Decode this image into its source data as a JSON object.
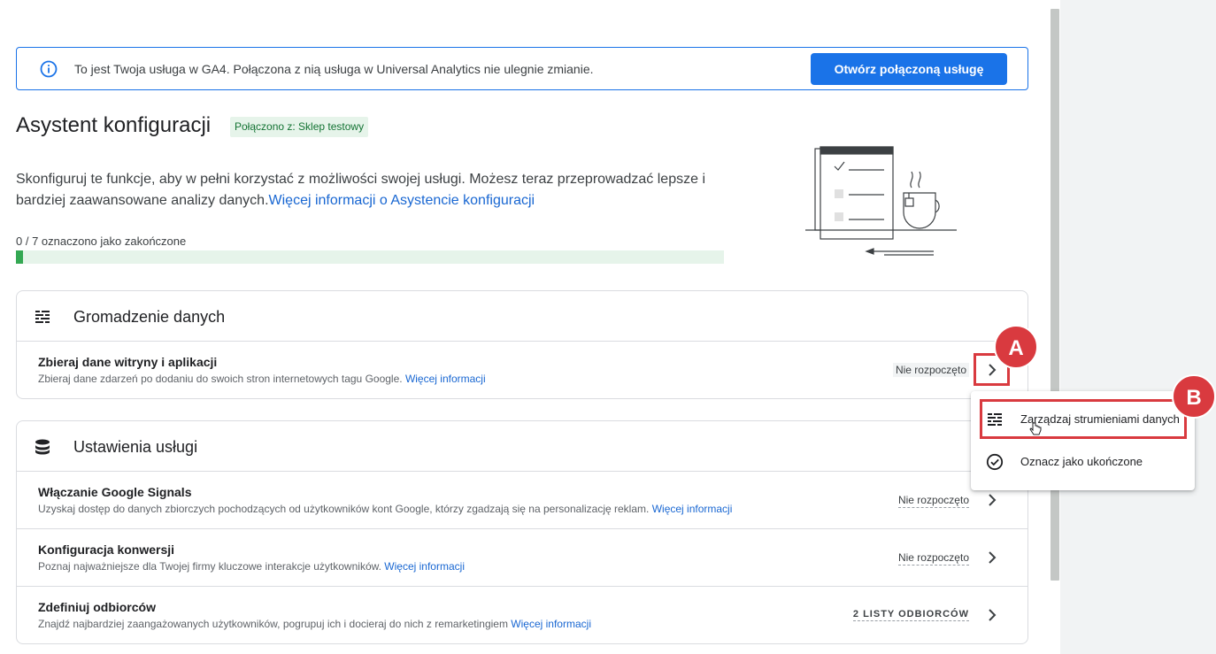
{
  "banner": {
    "text": "To jest Twoja usługa w GA4. Połączona z nią usługa w Universal Analytics nie ulegnie zmianie.",
    "button_label": "Otwórz połączoną usługę"
  },
  "header": {
    "title": "Asystent konfiguracji",
    "connected_chip": "Połączono z: Sklep testowy"
  },
  "intro": {
    "text": "Skonfiguruj te funkcje, aby w pełni korzystać z możliwości swojej usługi. Możesz teraz przeprowadzać lepsze i bardziej zaawansowane analizy danych.",
    "link": "Więcej informacji o Asystencie konfiguracji"
  },
  "progress": {
    "label": "0 / 7 oznaczono jako zakończone",
    "completed": 0,
    "total": 7
  },
  "sections": [
    {
      "title": "Gromadzenie danych",
      "icon": "data-streams-icon",
      "rows": [
        {
          "title": "Zbieraj dane witryny i aplikacji",
          "desc": "Zbieraj dane zdarzeń po dodaniu do swoich stron internetowych tagu Google.",
          "link": "Więcej informacji",
          "status": "Nie rozpoczęto"
        }
      ]
    },
    {
      "title": "Ustawienia usługi",
      "icon": "database-icon",
      "rows": [
        {
          "title": "Włączanie Google Signals",
          "desc": "Uzyskaj dostęp do danych zbiorczych pochodzących od użytkowników kont Google, którzy zgadzają się na personalizację reklam.",
          "link": "Więcej informacji",
          "status": "Nie rozpoczęto"
        },
        {
          "title": "Konfiguracja konwersji",
          "desc": "Poznaj najważniejsze dla Twojej firmy kluczowe interakcje użytkowników.",
          "link": "Więcej informacji",
          "status": "Nie rozpoczęto"
        },
        {
          "title": "Zdefiniuj odbiorców",
          "desc": "Znajdź najbardziej zaangażowanych użytkowników, pogrupuj ich i docieraj do nich z remarketingiem",
          "link": "Więcej informacji",
          "status": "2 LISTY ODBIORCÓW"
        }
      ]
    }
  ],
  "menu": {
    "items": [
      {
        "label": "Zarządzaj strumieniami danych",
        "icon": "data-streams-icon"
      },
      {
        "label": "Oznacz jako ukończone",
        "icon": "check-circle-icon"
      }
    ]
  },
  "annotations": {
    "a": "A",
    "b": "B"
  },
  "colors": {
    "accent": "#1a73e8",
    "annotation": "#d93a3f",
    "progress": "#34a853"
  }
}
